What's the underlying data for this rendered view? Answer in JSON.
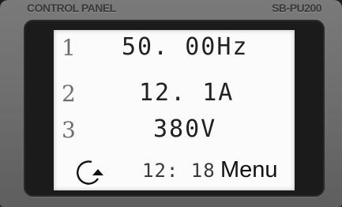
{
  "header": {
    "left_label": "CONTROL PANEL",
    "right_label": "SB-PU200"
  },
  "display": {
    "rows": [
      {
        "index": "1",
        "value": "50. 00Hz"
      },
      {
        "index": "2",
        "value": "12. 1A"
      },
      {
        "index": "3",
        "value": "380V"
      }
    ],
    "time": "12: 18",
    "menu_label": "Menu",
    "status_icon": "rotate-clockwise-icon"
  },
  "colors": {
    "panel": "#6c6c6c",
    "bezel": "#1b1b1b",
    "screen": "#fbfbfb",
    "text": "#222222"
  }
}
